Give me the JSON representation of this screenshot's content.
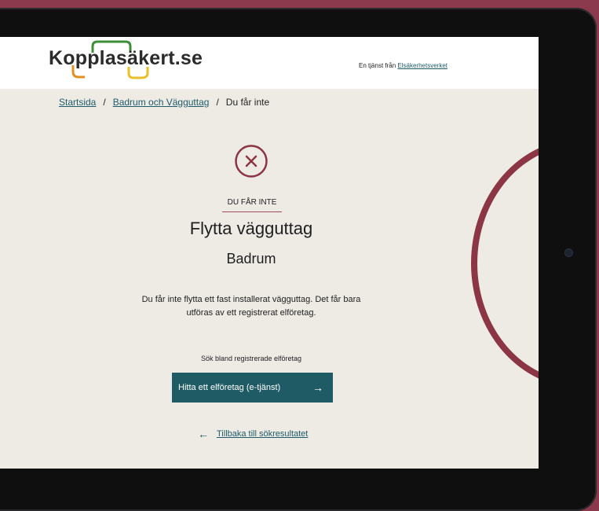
{
  "header": {
    "logo_text": "Kopplasäkert.se",
    "agency_prefix": "En tjänst från",
    "agency_link": "Elsäkerhetsverket"
  },
  "breadcrumb": {
    "items": [
      "Startsida",
      "Badrum och Vägguttag"
    ],
    "current": "Du får inte",
    "separator": "/"
  },
  "result": {
    "icon": "x-circle-icon",
    "kicker": "DU FÅR INTE",
    "title": "Flytta vägguttag",
    "subtitle": "Badrum",
    "description": "Du får inte flytta ett fast installerat vägguttag. Det får bara utföras av ett registrerat elföretag.",
    "search_label": "Sök bland registrerade elföretag",
    "cta_label": "Hitta ett elföretag (e-tjänst)",
    "back_label": "Tillbaka till sökresultatet"
  },
  "colors": {
    "accent_dark_red": "#8b3545",
    "teal": "#1f5b65",
    "background": "#eeebe5",
    "logo_green": "#3e8f3a",
    "logo_orange": "#e2901f",
    "logo_yellow": "#e8c02a"
  }
}
